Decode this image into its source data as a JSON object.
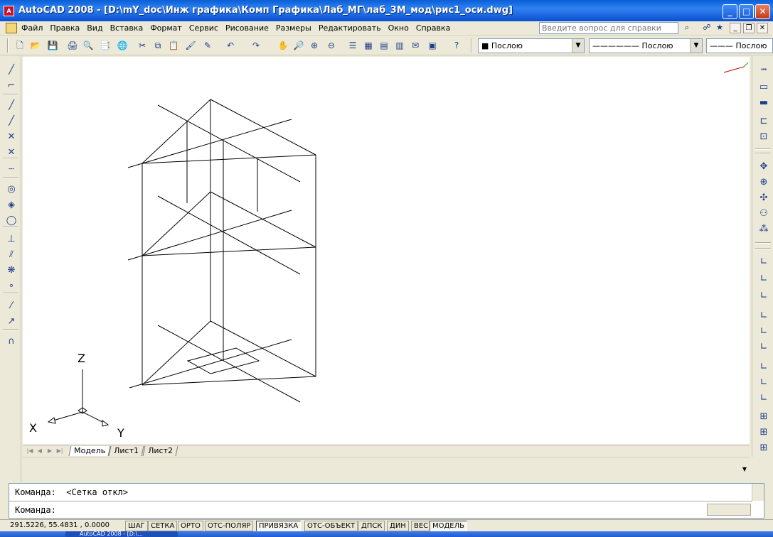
{
  "window": {
    "title": "AutoCAD 2008 - [D:\\mY_doc\\Инж графика\\Комп Графика\\Лаб_МГ\\лаб_3М_мод\\рис1_оси.dwg]",
    "minimize": "_",
    "maximize": "□",
    "close": "✕"
  },
  "menu": {
    "items": [
      "Файл",
      "Правка",
      "Вид",
      "Вставка",
      "Формат",
      "Сервис",
      "Рисование",
      "Размеры",
      "Редактировать",
      "Окно",
      "Справка"
    ],
    "help_placeholder": "Введите вопрос для справки",
    "doc_min": "_",
    "doc_restore": "❐",
    "doc_close": "✕"
  },
  "toolbar": {
    "color_combo": "■ Послою",
    "linetype_combo": "——————  Послою",
    "lineweight_combo": "——— Послою",
    "combo_arrow": "▼"
  },
  "icons": {
    "standard": [
      "new-icon",
      "open-icon",
      "save-icon",
      "plot-icon",
      "preview-icon",
      "publish-icon",
      "3d-dwf-icon",
      "cut-icon",
      "copy-icon",
      "paste-icon",
      "match-icon",
      "block-editor-icon",
      "undo-icon",
      "redo-icon",
      "pan-icon",
      "zoom-realtime-icon",
      "zoom-window-icon",
      "zoom-previous-icon",
      "properties-icon",
      "design-center-icon",
      "tool-palettes-icon",
      "sheet-set-icon",
      "markup-icon",
      "calculator-icon",
      "help-icon"
    ],
    "standard_glyphs": [
      "🗋",
      "📂",
      "💾",
      "🖨",
      "🔍",
      "📑",
      "🌐",
      "✂",
      "⧉",
      "📋",
      "🖌",
      "✎",
      "↶",
      "↷",
      "✋",
      "🔎",
      "⊕",
      "⊖",
      "☰",
      "▦",
      "▤",
      "▥",
      "✉",
      "▣",
      "?"
    ],
    "left": [
      "line-icon",
      "construction-line-icon",
      "polyline-icon",
      "polygon-icon",
      "rectangle-icon",
      "arc-icon",
      "circle-icon",
      "revision-cloud-icon",
      "spline-icon",
      "ellipse-icon",
      "ellipse-arc-icon",
      "insert-block-icon",
      "make-block-icon",
      "point-icon",
      "hatch-icon",
      "gradient-icon",
      "region-icon"
    ],
    "left_glyphs": [
      "╱",
      "⌐",
      "╱",
      "╱",
      "✕",
      "✕",
      "┄",
      "◎",
      "◈",
      "◯",
      "⊥",
      "⫽",
      "❋",
      "∘",
      "⁄",
      "↗",
      "∩"
    ],
    "right": [
      "dim-linear-icon",
      "dim-aligned-icon",
      "dim-arc-icon",
      "dim-ordinate-icon",
      "dim-radius-icon",
      "orbit-icon",
      "zoom-icon",
      "pan-3d-icon",
      "camera-icon",
      "walk-icon",
      "ucs-icon",
      "ucs-world-icon",
      "ucs-previous-icon",
      "ucs-face-icon",
      "ucs-object-icon",
      "ucs-view-icon",
      "ucs-origin-icon",
      "ucs-zaxis-icon",
      "ucs-3point-icon",
      "ucs-x-icon",
      "ucs-y-icon",
      "ucs-z-icon",
      "ucs-apply-icon"
    ],
    "right_glyphs": [
      "┅",
      "▭",
      "▬",
      "⊏",
      "⊡",
      "✥",
      "⊕",
      "✣",
      "⚇",
      "⁂",
      "∟",
      "∟",
      "∟",
      "∟",
      "∟",
      "∟",
      "∟",
      "∟",
      "∟",
      "⊞",
      "⊞",
      "⊞",
      "⊞"
    ]
  },
  "ucs": {
    "x": "X",
    "y": "Y",
    "z": "Z"
  },
  "tabs": {
    "nav": [
      "|◀",
      "◀",
      "▶",
      "▶|"
    ],
    "items": [
      "Модель",
      "Лист1",
      "Лист2"
    ]
  },
  "command": {
    "history": "Команда:  <Сетка откл>",
    "prompt": "Команда:"
  },
  "status": {
    "coords": "291.5226, 55.4831 , 0.0000",
    "buttons": [
      "ШАГ",
      "СЕТКА",
      "ОРТО",
      "ОТС-ПОЛЯР",
      "ПРИВЯЗКА",
      "ОТС-ОБЪЕКТ",
      "ДПСК",
      "ДИН",
      "ВЕС",
      "МОДЕЛЬ"
    ],
    "active": [
      false,
      false,
      false,
      false,
      true,
      false,
      false,
      false,
      false,
      true
    ]
  },
  "taskbar": {
    "task": "AutoCAD 2008 - [D:\\..."
  },
  "colors": {
    "titlebar": "#0a5fd8",
    "canvas": "#ffffff",
    "chrome": "#ece9d8"
  }
}
